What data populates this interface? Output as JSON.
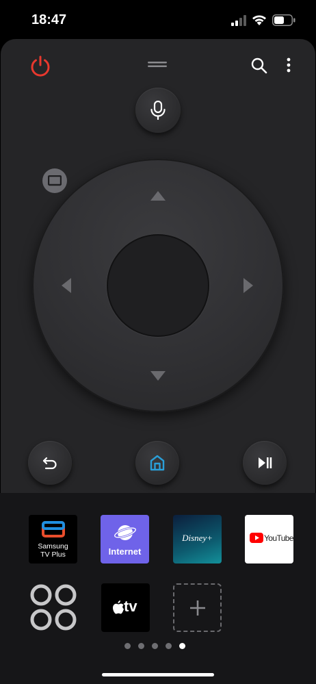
{
  "status_bar": {
    "time": "18:47",
    "icons": [
      "signal-icon",
      "wifi-icon",
      "battery-icon"
    ]
  },
  "toolbar": {
    "power_icon": "power-icon",
    "handle_icon": "drag-handle-icon",
    "search_icon": "search-icon",
    "more_icon": "more-vertical-icon"
  },
  "remote": {
    "mic_icon": "microphone-icon",
    "source_icon": "source-input-icon",
    "dpad_icons": [
      "arrow-up-icon",
      "arrow-down-icon",
      "arrow-left-icon",
      "arrow-right-icon"
    ],
    "bottom_buttons": [
      "back-icon",
      "home-icon",
      "play-pause-icon"
    ]
  },
  "apps": {
    "samsung_tv_plus": "Samsung\nTV Plus",
    "internet": "Internet",
    "disney": "Disney+",
    "youtube": "YouTube",
    "apple_tv": "tv",
    "more_apps_icon": "apps-grid-icon",
    "add_icon": "plus-icon"
  },
  "pager": {
    "count": 5,
    "active_index": 4
  },
  "colors": {
    "power": "#e8382e",
    "home_accent": "#2a9fd8",
    "panel": "#252527",
    "apps_panel": "#161618"
  }
}
